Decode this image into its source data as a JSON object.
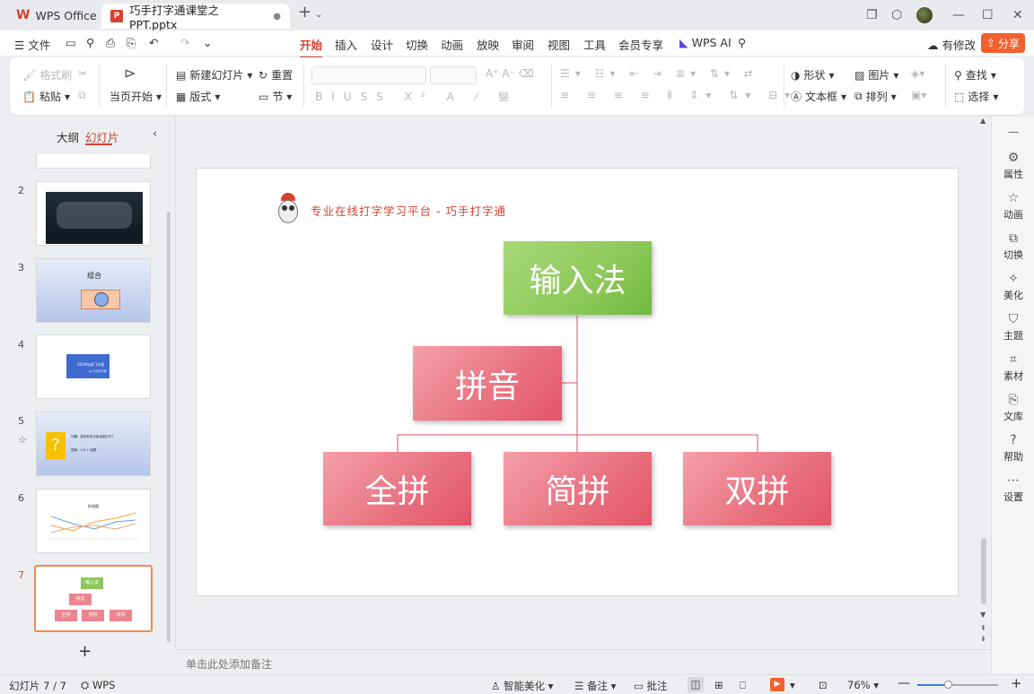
{
  "titlebar": {
    "app_name": "WPS Office",
    "file_tab": "巧手打字通课堂之PPT.pptx",
    "new_tab": "+"
  },
  "menubar": {
    "file": "文件",
    "items": [
      "开始",
      "插入",
      "设计",
      "切换",
      "动画",
      "放映",
      "审阅",
      "视图",
      "工具",
      "会员专享"
    ],
    "ai": "WPS AI",
    "modified": "有修改",
    "share": "分享"
  },
  "ribbon": {
    "format_brush": "格式刷",
    "paste": "粘贴",
    "play_from_start": "当页开始",
    "new_slide": "新建幻灯片",
    "layout": "版式",
    "reset": "重置",
    "section": "节",
    "shape": "形状",
    "textbox": "文本框",
    "picture": "图片",
    "arrange": "排列",
    "find": "查找",
    "select": "选择"
  },
  "left_panel": {
    "tab_outline": "大纲",
    "tab_slides": "幻灯片",
    "slide_numbers": [
      "2",
      "3",
      "4",
      "5",
      "6",
      "7"
    ],
    "add": "+"
  },
  "thumbs": {
    "t3_title": "组合",
    "t4_title": "2019年部门年报",
    "t4_sub": "by 巧手打字通",
    "t5_line1": "问题：如何利用平板电脑打字？",
    "t5_line2": "答案：1/3 + 回顾",
    "t6_title": "折线图",
    "q": "?",
    "t7_top": "输入法",
    "t7_mid": "拼音",
    "t7_a": "全拼",
    "t7_b": "简拼",
    "t7_c": "双拼"
  },
  "slide": {
    "header": "专业在线打字学习平台 - 巧手打字通",
    "root": "输入法",
    "mid": "拼音",
    "leaf1": "全拼",
    "leaf2": "简拼",
    "leaf3": "双拼"
  },
  "notes_placeholder": "单击此处添加备注",
  "right_sidebar": [
    "属性",
    "动画",
    "切换",
    "美化",
    "主题",
    "素材",
    "文库",
    "帮助",
    "设置"
  ],
  "statusbar": {
    "slide_count": "幻灯片 7 / 7",
    "wps": "WPS",
    "smart": "智能美化",
    "notes": "备注",
    "comments": "批注",
    "zoom": "76%"
  },
  "colors": {
    "accent": "#d2432f",
    "share": "#f2602e",
    "box_pink": "#e9707f",
    "box_green": "#8cc95a"
  }
}
